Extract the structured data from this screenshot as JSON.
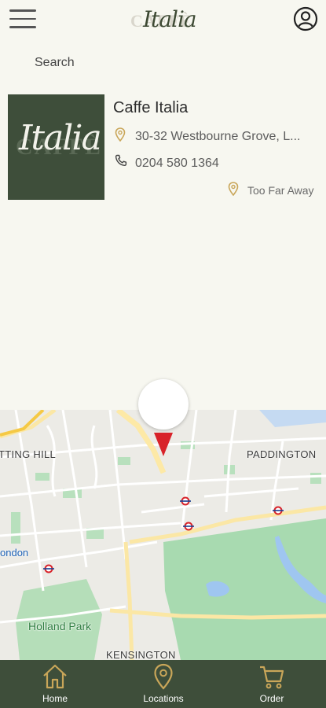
{
  "header": {
    "logo_text": "Italia",
    "logo_backdrop": "CAFFÈ"
  },
  "search": {
    "label": "Search"
  },
  "locations": [
    {
      "name": "Caffe Italia",
      "address": "30-32 Westbourne Grove, L...",
      "phone": "0204 580 1364",
      "distance": "Too Far Away",
      "thumb_text": "Italia",
      "thumb_backdrop": "CAFFÈ"
    }
  ],
  "map": {
    "labels": {
      "notting_hill": "TTING HILL",
      "paddington": "PADDINGTON",
      "london": "ondon",
      "holland_park": "Holland Park",
      "kensington": "KENSINGTON"
    }
  },
  "nav": {
    "items": [
      {
        "label": "Home",
        "icon": "home-icon"
      },
      {
        "label": "Locations",
        "icon": "location-pin-icon"
      },
      {
        "label": "Order",
        "icon": "cart-icon"
      }
    ]
  },
  "colors": {
    "background": "#f7f7f0",
    "brand_green": "#3e4e3a",
    "accent_gold": "#c9a659",
    "pin_red": "#d8232a"
  }
}
